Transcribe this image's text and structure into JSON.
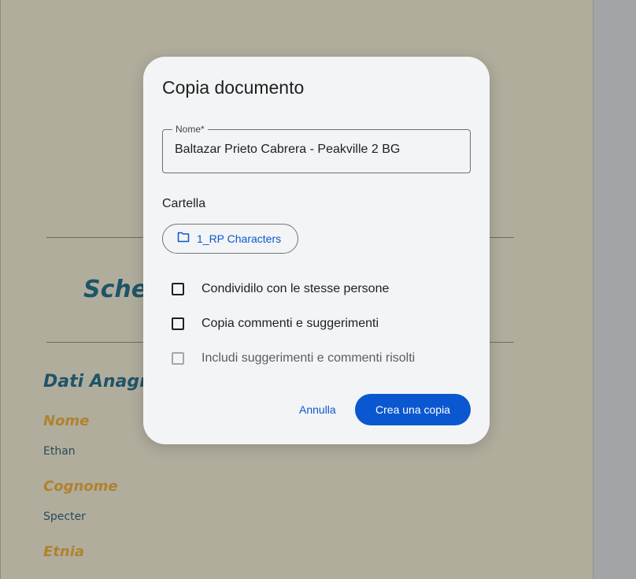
{
  "background": {
    "title_fragment": "Schec",
    "section_fragment": "Dati Anagraf",
    "fields": [
      {
        "label": "Nome",
        "value": "Ethan"
      },
      {
        "label": "Cognome",
        "value": "Specter"
      },
      {
        "label": "Etnia",
        "value": ""
      }
    ]
  },
  "dialog": {
    "title": "Copia documento",
    "name_field": {
      "label": "Nome*",
      "value": "Baltazar Prieto Cabrera - Peakville 2 BG"
    },
    "folder_heading": "Cartella",
    "folder_chip": {
      "label": "1_RP Characters",
      "icon": "folder-icon"
    },
    "options": [
      {
        "label": "Condividilo con le stesse persone",
        "checked": false,
        "disabled": false
      },
      {
        "label": "Copia commenti e suggerimenti",
        "checked": false,
        "disabled": false
      },
      {
        "label": "Includi suggerimenti e commenti risolti",
        "checked": false,
        "disabled": true
      }
    ],
    "cancel_label": "Annulla",
    "confirm_label": "Crea una copia"
  },
  "colors": {
    "accent": "#0b57d0",
    "field_label_gold": "#b0822e",
    "heading_teal": "#1f5467"
  }
}
